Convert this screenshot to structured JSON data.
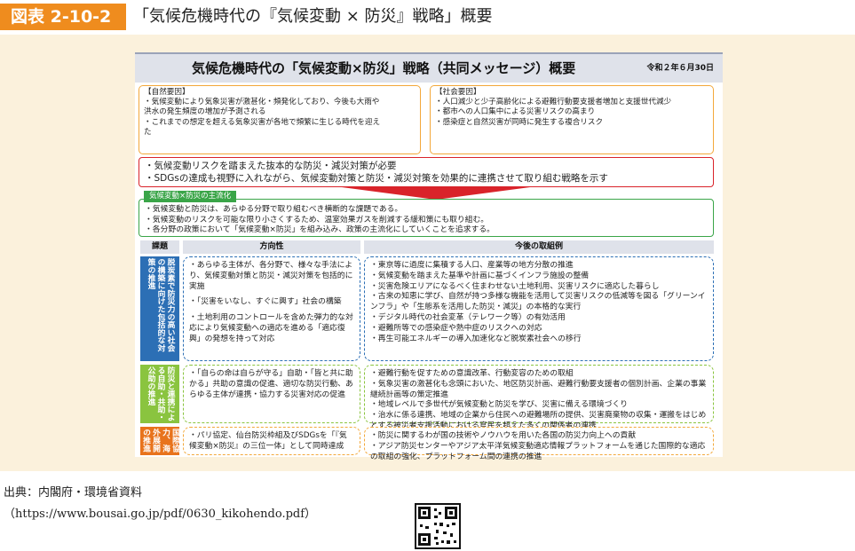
{
  "header": {
    "badge": "図表 2-10-2",
    "title": "「気候危機時代の『気候変動 × 防災』戦略」概要"
  },
  "card": {
    "title": "気候危機時代の「気候変動×防災」戦略（共同メッセージ）概要",
    "date": "令和２年６月30日"
  },
  "natural_factors": {
    "heading": "【自然要因】",
    "lines": [
      "・気候変動により気象災害が激甚化・頻発化しており、今後も大雨や",
      "洪水の発生頻度の増加が予測される",
      "・これまでの想定を超える気象災害が各地で頻繁に生じる時代を迎え",
      "た"
    ]
  },
  "social_factors": {
    "heading": "【社会要因】",
    "lines": [
      "・人口減少と少子高齢化による避難行動要支援者増加と支援世代減少",
      "・都市への人口集中による災害リスクの高まり",
      "・感染症と自然災害が同時に発生する複合リスク"
    ]
  },
  "key_message": {
    "lines": [
      "・気候変動リスクを踏まえた抜本的な防災・減災対策が必要",
      "・SDGsの達成も視野に入れながら、気候変動対策と防災・減災対策を効果的に連携させて取り組む戦略を示す"
    ]
  },
  "mainstreaming": {
    "tag": "気候変動×防災の主流化",
    "lines": [
      "・気候変動と防災は、あらゆる分野で取り組むべき横断的な課題である。",
      "・気候変動のリスクを可能な限り小さくするため、温室効果ガスを削減する緩和策にも取り組む。",
      "・各分野の政策において「気候変動×防災」を組み込み、政策の主流化にしていくことを追求する。"
    ]
  },
  "table": {
    "headers": [
      "課題",
      "方向性",
      "今後の取組例"
    ],
    "rows": [
      {
        "issue": "脱炭素で防災力の高い社会の構築に向けた包括的な対策の推進",
        "direction": [
          "・あらゆる主体が、各分野で、様々な手法により、気候変動対策と防災・減災対策を包括的に実施",
          "・「災害をいなし、すぐに興す」社会の構築",
          "・土地利用のコントロールを含めた弾力的な対応により気候変動への適応を進める「適応復興」の発想を持って対応"
        ],
        "examples": [
          "・東京等に過度に集積する人口、産業等の地方分散の推進",
          "・気候変動を踏まえた基準や計画に基づくインフラ施設の整備",
          "・災害危険エリアになるべく住まわせない土地利用、災害リスクに適応した暮らし",
          "・古来の知恵に学び、自然が持つ多様な機能を活用して災害リスクの低減等を図る「グリーンインフラ」や「生態系を活用した防災・減災」の本格的な実行",
          "・デジタル時代の社会変革（テレワーク等）の有効活用",
          "・避難所等での感染症や熱中症のリスクへの対応",
          "・再生可能エネルギーの導入加速化など脱炭素社会への移行"
        ]
      },
      {
        "issue": "防災と連携による自助・共助・公助の推進",
        "direction": [
          "・「自らの命は自らが守る」自助・「皆と共に助かる」共助の意識の促進、適切な防災行動、あらゆる主体が連携・協力する災害対応の促進"
        ],
        "examples": [
          "・避難行動を促すための意識改革、行動変容のための取組",
          "・気象災害の激甚化も念頭においた、地区防災計画、避難行動要支援者の個別計画、企業の事業継続計画等の策定推進",
          "・地域レベルで多世代が気候変動と防災を学び、災害に備える環境づくり",
          "・治水に係る連携、地域の企業から住民への避難場所の提供、災害廃棄物の収集・運搬をはじめとする被災者支援活動における官民を超えた多くの関係者の連携"
        ]
      },
      {
        "issue": "国際協力、海外展開の推進",
        "direction": [
          "・パリ協定、仙台防災枠組及びSDGsを「『気候変動×防災』の三位一体」として同時達成"
        ],
        "examples": [
          "・防災に関するわが国の技術やノウハウを用いた各国の防災力向上への貢献",
          "・アジア防災センターやアジア太平洋気候変動適応情報プラットフォームを通じた国際的な適応の取組の強化、プラットフォーム間の連携の推進"
        ]
      }
    ]
  },
  "source": {
    "line1": "出典：内閣府・環境省資料",
    "line2": "（https://www.bousai.go.jp/pdf/0630_kikohendo.pdf）"
  },
  "colors": {
    "orange": "#ef8c1e",
    "red": "#d9232a",
    "green": "#3aa548",
    "blue": "#2c6fb5",
    "light_green": "#8ac43f",
    "label_blue": "#2c6fb5",
    "label_green": "#8ac43f",
    "label_orange": "#e8731c"
  }
}
